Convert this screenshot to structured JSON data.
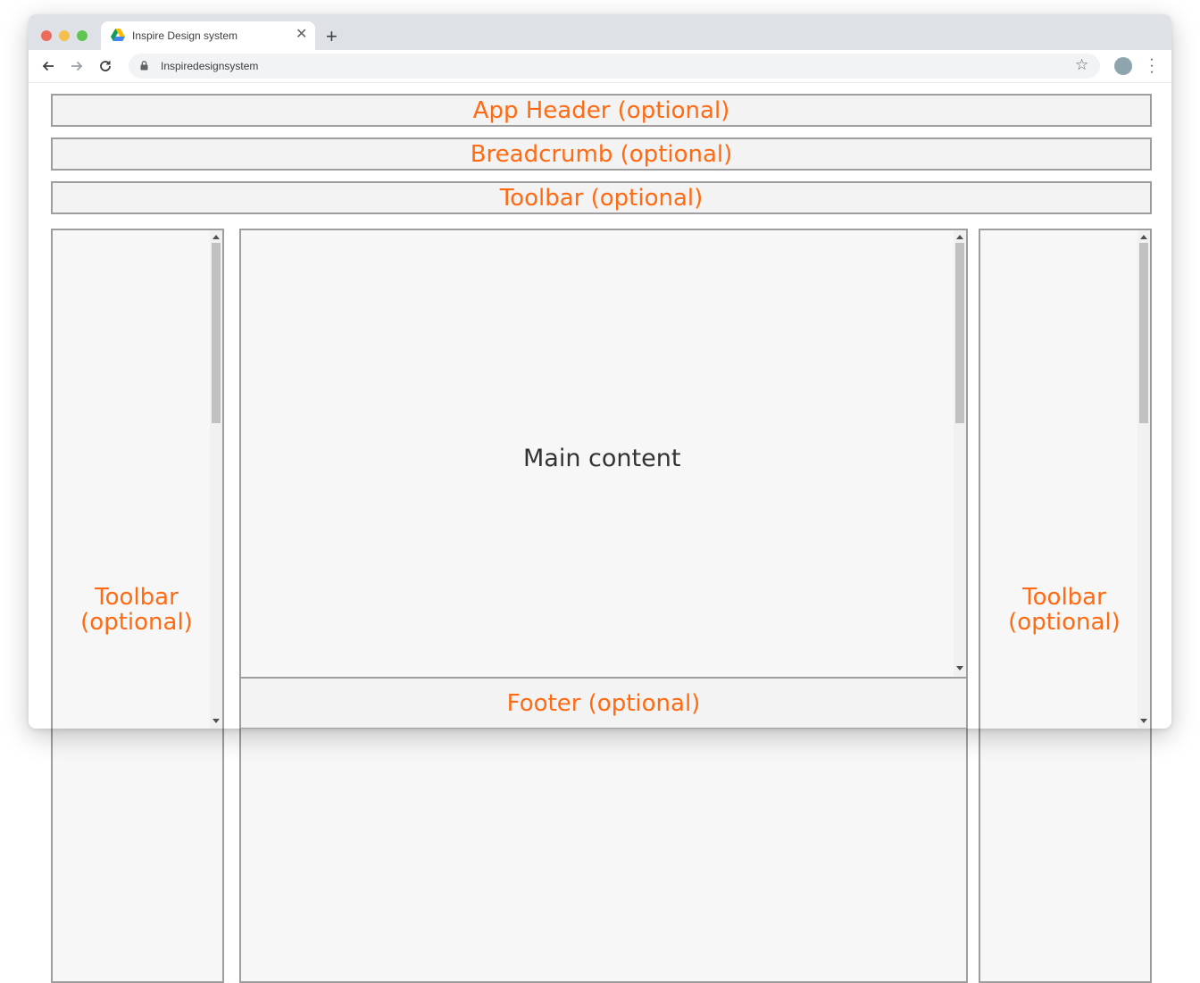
{
  "browser": {
    "tab_title": "Inspire Design system",
    "url": "Inspiredesignsystem",
    "window_controls": [
      "close",
      "minimize",
      "maximize"
    ]
  },
  "layout": {
    "app_header": "App Header (optional)",
    "breadcrumb": "Breadcrumb (optional)",
    "top_toolbar": "Toolbar (optional)",
    "left_toolbar_line1": "Toolbar",
    "left_toolbar_line2": "(optional)",
    "main_content": "Main content",
    "footer": "Footer (optional)",
    "right_toolbar_line1": "Toolbar",
    "right_toolbar_line2": "(optional)"
  },
  "colors": {
    "accent": "#ff6a13",
    "border": "#9e9e9e",
    "panel_bg": "#f7f7f7",
    "chrome_bg": "#dee1e6"
  },
  "icons": [
    "drive-icon",
    "close-icon",
    "plus-icon",
    "back-icon",
    "forward-icon",
    "reload-icon",
    "lock-icon",
    "star-icon",
    "menu-dots-icon"
  ]
}
